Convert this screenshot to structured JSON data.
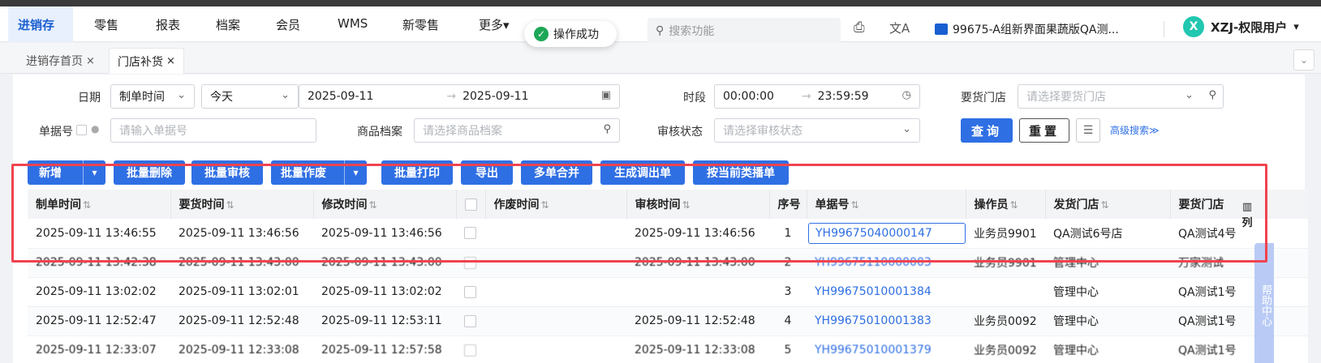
{
  "nav": {
    "items": [
      {
        "label": "进销存",
        "active": true
      },
      {
        "label": "零售"
      },
      {
        "label": "报表"
      },
      {
        "label": "档案"
      },
      {
        "label": "会员"
      },
      {
        "label": "WMS"
      },
      {
        "label": "新零售"
      },
      {
        "label": "更多▾"
      }
    ],
    "toast": "操作成功",
    "search_placeholder": "搜索功能",
    "store": "99675-A组新界面果蔬版QA测...",
    "user_initial": "X",
    "user_name": "XZJ-权限用户",
    "user_arrow": "▾"
  },
  "tabs": [
    {
      "label": "进销存首页",
      "close": "×"
    },
    {
      "label": "门店补货",
      "close": "×",
      "active": true
    }
  ],
  "filters": {
    "date_label": "日期",
    "date_type": "制单时间",
    "date_preset": "今天",
    "date_from": "2025-09-11",
    "date_to": "2025-09-11",
    "period_label": "时段",
    "time_from": "00:00:00",
    "time_to": "23:59:59",
    "req_store_label": "要货门店",
    "req_store_placeholder": "请选择要货门店",
    "doc_no_label": "单据号",
    "doc_no_placeholder": "请输入单据号",
    "goods_label": "商品档案",
    "goods_placeholder": "请选择商品档案",
    "audit_label": "审核状态",
    "audit_placeholder": "请选择审核状态",
    "query": "查询",
    "reset": "重置",
    "advanced": "高级搜索≫"
  },
  "actions": [
    "新增",
    "批量删除",
    "批量审核",
    "批量作废",
    "批量打印",
    "导出",
    "多单合并",
    "生成调出单",
    "按当前类播单"
  ],
  "table": {
    "columns": [
      "制单时间",
      "要货时间",
      "修改时间",
      "",
      "作废时间",
      "审核时间",
      "序号",
      "单据号",
      "操作员",
      "发货门店",
      "要货门店"
    ],
    "rows": [
      [
        "2025-09-11 13:46:55",
        "2025-09-11 13:46:56",
        "2025-09-11 13:46:56",
        "",
        "",
        "2025-09-11 13:46:56",
        "1",
        "YH99675040000147",
        "业务员9901",
        "QA测试6号店",
        "QA测试4号"
      ],
      [
        "2025-09-11 13:42:38",
        "2025-09-11 13:43:00",
        "2025-09-11 13:43:00",
        "",
        "",
        "2025-09-11 13:43:00",
        "2",
        "YH99675110000003",
        "业务员9901",
        "管理中心",
        "万家测试"
      ],
      [
        "2025-09-11 13:02:02",
        "2025-09-11 13:02:01",
        "2025-09-11 13:02:02",
        "",
        "",
        "",
        "3",
        "YH99675010001384",
        "",
        "管理中心",
        "QA测试1号"
      ],
      [
        "2025-09-11 12:52:47",
        "2025-09-11 12:52:48",
        "2025-09-11 12:53:11",
        "",
        "",
        "2025-09-11 12:52:48",
        "4",
        "YH99675010001383",
        "业务员0092",
        "管理中心",
        "QA测试1号"
      ],
      [
        "2025-09-11 12:33:07",
        "2025-09-11 12:33:08",
        "2025-09-11 12:57:58",
        "",
        "",
        "2025-09-11 12:33:08",
        "5",
        "YH99675010001379",
        "业务员0092",
        "管理中心",
        "QA测试1号"
      ]
    ]
  },
  "col_settings": "列",
  "help": "帮助中心"
}
